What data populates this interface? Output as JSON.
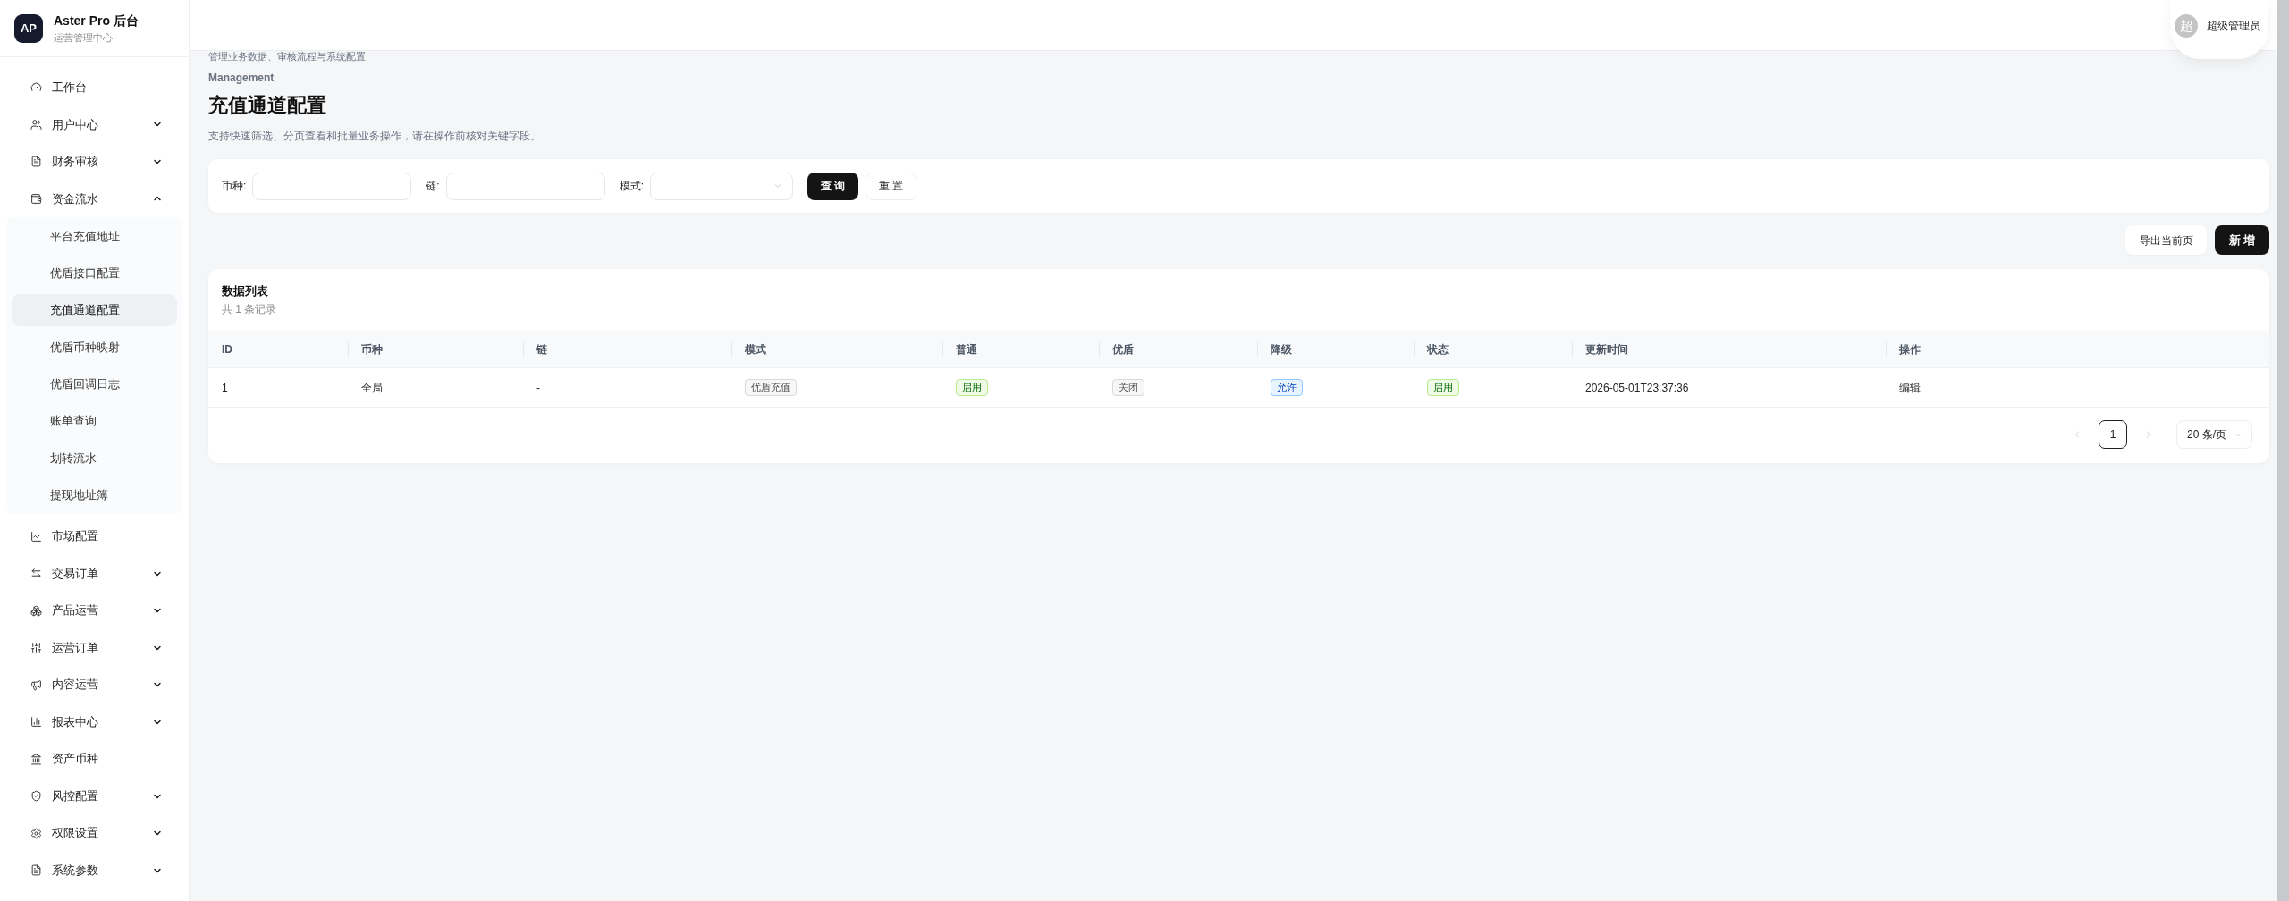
{
  "sidebar": {
    "logo": {
      "mark": "AP",
      "title": "Aster Pro 后台",
      "subtitle": "运营管理中心"
    },
    "items": [
      {
        "label": "工作台",
        "kind": "link"
      },
      {
        "label": "用户中心",
        "kind": "group",
        "expanded": false
      },
      {
        "label": "财务审核",
        "kind": "group",
        "expanded": false
      },
      {
        "label": "资金流水",
        "kind": "group",
        "expanded": true,
        "children": [
          {
            "label": "平台充值地址",
            "selected": false
          },
          {
            "label": "优盾接口配置",
            "selected": false
          },
          {
            "label": "充值通道配置",
            "selected": true
          },
          {
            "label": "优盾币种映射",
            "selected": false
          },
          {
            "label": "优盾回调日志",
            "selected": false
          },
          {
            "label": "账单查询",
            "selected": false
          },
          {
            "label": "划转流水",
            "selected": false
          },
          {
            "label": "提现地址簿",
            "selected": false
          }
        ]
      },
      {
        "label": "市场配置",
        "kind": "link"
      },
      {
        "label": "交易订单",
        "kind": "group",
        "expanded": false
      },
      {
        "label": "产品运营",
        "kind": "group",
        "expanded": false
      },
      {
        "label": "运营订单",
        "kind": "group",
        "expanded": false
      },
      {
        "label": "内容运营",
        "kind": "group",
        "expanded": false
      },
      {
        "label": "报表中心",
        "kind": "group",
        "expanded": false
      },
      {
        "label": "资产币种",
        "kind": "link"
      },
      {
        "label": "风控配置",
        "kind": "group",
        "expanded": false
      },
      {
        "label": "权限设置",
        "kind": "group",
        "expanded": false
      },
      {
        "label": "系统参数",
        "kind": "group",
        "expanded": false
      }
    ]
  },
  "header": {
    "user": {
      "avatar": "超",
      "name": "超级管理员"
    }
  },
  "page": {
    "subtitle": "管理业务数据、审核流程与系统配置",
    "eyebrow": "Management",
    "title": "充值通道配置",
    "description": "支持快速筛选、分页查看和批量业务操作，请在操作前核对关键字段。"
  },
  "filters": {
    "fields": [
      {
        "label": "币种:",
        "kind": "input"
      },
      {
        "label": "链:",
        "kind": "input"
      },
      {
        "label": "模式:",
        "kind": "select"
      }
    ],
    "buttons": [
      {
        "label": "查 询",
        "kind": "primary"
      },
      {
        "label": "重 置",
        "kind": "default"
      }
    ]
  },
  "toolbar": {
    "buttons": [
      {
        "label": "导出当前页",
        "kind": "default"
      },
      {
        "label": "新 增",
        "kind": "primary"
      }
    ]
  },
  "table": {
    "title": "数据列表",
    "count": "共 1 条记录",
    "columns": [
      "ID",
      "币种",
      "链",
      "模式",
      "普通",
      "优盾",
      "降级",
      "状态",
      "更新时间",
      "操作"
    ],
    "rows": [
      {
        "cells": [
          {
            "kind": "text",
            "text": "1"
          },
          {
            "kind": "text",
            "text": "全局"
          },
          {
            "kind": "text",
            "text": "-"
          },
          {
            "kind": "tag",
            "text": "优盾充值",
            "color": "#d9d9d9"
          },
          {
            "kind": "tag",
            "text": "启用",
            "color": "#b7eb8f"
          },
          {
            "kind": "tag",
            "text": "关闭",
            "color": "#d9d9d9"
          },
          {
            "kind": "tag",
            "text": "允许",
            "color": "#91caff"
          },
          {
            "kind": "tag",
            "text": "启用",
            "color": "#b7eb8f"
          },
          {
            "kind": "text",
            "text": "2026-05-01T23:37:36"
          },
          {
            "kind": "link",
            "text": "编辑"
          }
        ]
      }
    ]
  },
  "pagination": {
    "prev": {
      "disabled": true
    },
    "pages": [
      {
        "label": "1",
        "selected": true
      }
    ],
    "next": {
      "disabled": true
    },
    "page_size": "20 条/页"
  }
}
